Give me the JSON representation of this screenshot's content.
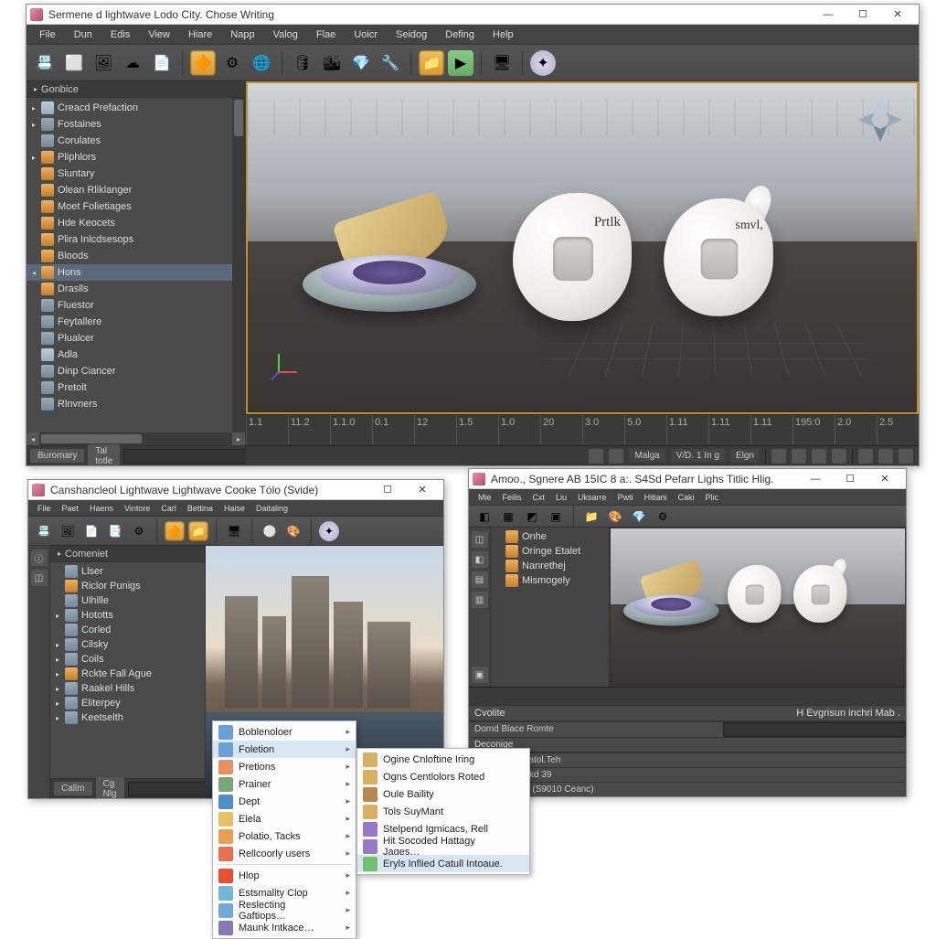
{
  "win1": {
    "title": "Sermene d lightwave Lodo City. Chose Writing",
    "menus": [
      "File",
      "Dun",
      "Edis",
      "View",
      "Hiare",
      "Napp",
      "Valog",
      "Flae",
      "Uoicr",
      "Seidog",
      "Defing",
      "Help"
    ],
    "side_header": "Gonbice",
    "tree": [
      {
        "t": "Creacd Prefaction",
        "i": "ti-pg",
        "a": "▸"
      },
      {
        "t": "Fostaines",
        "i": "ti-fold",
        "a": "▸"
      },
      {
        "t": "Corulates",
        "i": "ti-fold",
        "a": ""
      },
      {
        "t": "Pliphlors",
        "i": "ti-box",
        "a": "▸"
      },
      {
        "t": "Sluntary",
        "i": "ti-box",
        "a": ""
      },
      {
        "t": "Olean Rliklanger",
        "i": "ti-box",
        "a": ""
      },
      {
        "t": "Moet Folietiages",
        "i": "ti-box",
        "a": ""
      },
      {
        "t": "Hde Keocets",
        "i": "ti-box",
        "a": ""
      },
      {
        "t": "Plira Inlcdsesops",
        "i": "ti-box",
        "a": ""
      },
      {
        "t": "Bloods",
        "i": "ti-box",
        "a": ""
      },
      {
        "t": "Hons",
        "i": "ti-box",
        "a": "◂",
        "sel": true
      },
      {
        "t": "Draslls",
        "i": "ti-box",
        "a": ""
      },
      {
        "t": "Fluestor",
        "i": "ti-fold",
        "a": ""
      },
      {
        "t": "Feytallere",
        "i": "ti-fold",
        "a": ""
      },
      {
        "t": "Plualcer",
        "i": "ti-fold",
        "a": ""
      },
      {
        "t": "Adla",
        "i": "ti-pg",
        "a": ""
      },
      {
        "t": "Dinp Ciancer",
        "i": "ti-fold",
        "a": ""
      },
      {
        "t": "Pretolt",
        "i": "ti-fold",
        "a": ""
      },
      {
        "t": "Rlnvners",
        "i": "ti-fold",
        "a": ""
      }
    ],
    "foot1": "Buromary",
    "foot2": "Tal totle",
    "timeline": [
      "1.1",
      "11.2",
      "1.1.0",
      "0.1",
      "12",
      "1.5",
      "1.0",
      "20",
      "3.0",
      "5.0",
      "1.11",
      "1.11",
      "1.11",
      "195:0",
      "2.0",
      "2.5"
    ],
    "status": {
      "a": "Malga",
      "b": "V/D. 1 In g",
      "c": "Elgn"
    }
  },
  "win2": {
    "title": "Canshancleol Lightwave Lightwave Cooke Tólo (Svide)",
    "menus": [
      "File",
      "Paet",
      "Haens",
      "Vintore",
      "Carl",
      "Bettina",
      "Haise",
      "Daitaling"
    ],
    "side_header": "Comeniet",
    "tree": [
      {
        "t": "Llser",
        "i": "ti-fold",
        "a": ""
      },
      {
        "t": "Riclor Punigs",
        "i": "ti-box",
        "a": ""
      },
      {
        "t": "Ulhllle",
        "i": "ti-fold",
        "a": ""
      },
      {
        "t": "Hototts",
        "i": "ti-fold",
        "a": "▸"
      },
      {
        "t": "Corled",
        "i": "ti-fold",
        "a": ""
      },
      {
        "t": "Cilsky",
        "i": "ti-fold",
        "a": "▸"
      },
      {
        "t": "Coils",
        "i": "ti-fold",
        "a": "▸"
      },
      {
        "t": "Rckte Fall Ague",
        "i": "ti-box",
        "a": "▸"
      },
      {
        "t": "Raakel Hills",
        "i": "ti-fold",
        "a": "▸"
      },
      {
        "t": "Eliterpey",
        "i": "ti-fold",
        "a": "▸"
      },
      {
        "t": "Keetselth",
        "i": "ti-fold",
        "a": "▸"
      }
    ],
    "foot1": "Callm",
    "foot2": "Cg Nlg",
    "ctx1": [
      {
        "t": "Boblenoloer",
        "c": "#6aa0d8"
      },
      {
        "t": "Foletion",
        "c": "#6aa0d8",
        "hl": true
      },
      {
        "t": "Pretions",
        "c": "#e89060"
      },
      {
        "t": "Prainer",
        "c": "#78a878"
      },
      {
        "t": "Dept",
        "c": "#5090c8"
      },
      {
        "t": "Elela",
        "c": "#e8c060"
      },
      {
        "t": "Polatio, Tacks",
        "c": "#e8a050"
      },
      {
        "t": "Rellcoorly users",
        "c": "#e87050"
      },
      {
        "t": "Hlop",
        "c": "#e85030"
      },
      {
        "t": "Estsmality Clop",
        "c": "#70b8d8"
      },
      {
        "t": "Reslecting Gaftiops…",
        "c": "#70a8d8"
      },
      {
        "t": "Maunk Intkace…",
        "c": "#8878b8"
      }
    ],
    "ctx2": [
      {
        "t": "Ogine Cnloftine Iring",
        "c": "#d8b060"
      },
      {
        "t": "Ogns Centlolors Roted",
        "c": "#d8b060"
      },
      {
        "t": "Oule Baility",
        "c": "#b88850"
      },
      {
        "t": "Tols SuyMant",
        "c": "#d8b060"
      },
      {
        "t": "Stelpend Igmicacs, Rell",
        "c": "#9878c8"
      },
      {
        "t": "Hit Socoded Hattagy Jages…",
        "c": "#9878c8"
      },
      {
        "t": "Eryls Inflied Catull Intoaue.",
        "c": "#70c070",
        "hl": true
      }
    ]
  },
  "win3": {
    "title": "Amoo., Sgnere AB 15IC 8 a:. S4Sd Pefarr Lighs Titlic Hlig.",
    "menus": [
      "Mie",
      "Feilis",
      "Cxt",
      "Liu",
      "Uksarre",
      "Pwti",
      "Hitiani",
      "Caki",
      "Plic"
    ],
    "mini_tree": [
      "Onhe",
      "Oringe Etalet",
      "Nanrethej",
      "Mismogely"
    ],
    "sec1": "Cvolite",
    "row1": "Domd Blace Romte",
    "sec2": "Deconige",
    "props": [
      "Sublikenty Cratol.Teh",
      "Rteriase Intarkd 39",
      "sole Namdow (S9010 Ceanc)"
    ],
    "right_label": "H Evgrisun inchri Mab ."
  }
}
